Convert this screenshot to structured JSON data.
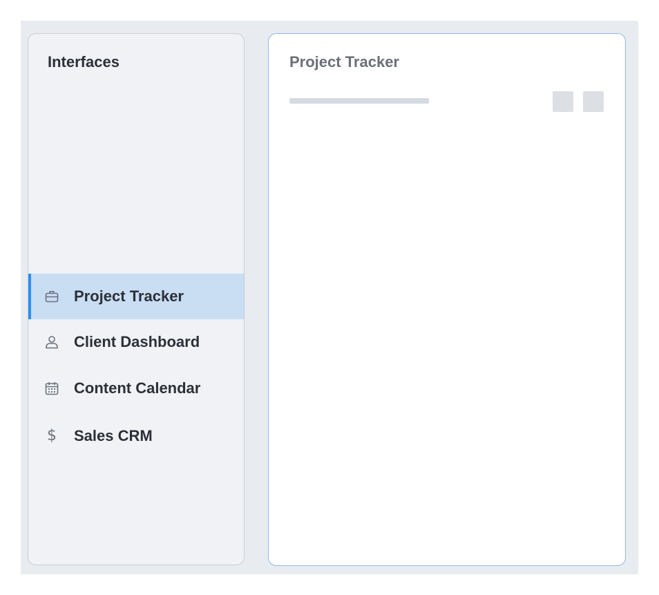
{
  "sidebar": {
    "title": "Interfaces",
    "items": [
      {
        "label": "Project Tracker",
        "icon": "briefcase-icon",
        "active": true
      },
      {
        "label": "Client Dashboard",
        "icon": "user-icon",
        "active": false
      },
      {
        "label": "Content Calendar",
        "icon": "calendar-icon",
        "active": false
      },
      {
        "label": "Sales CRM",
        "icon": "dollar-icon",
        "active": false
      }
    ]
  },
  "panel": {
    "title": "Project Tracker"
  },
  "colors": {
    "accent": "#2f8ef0",
    "active_bg": "#c9ddf3",
    "panel_border": "#8fb8ea"
  }
}
